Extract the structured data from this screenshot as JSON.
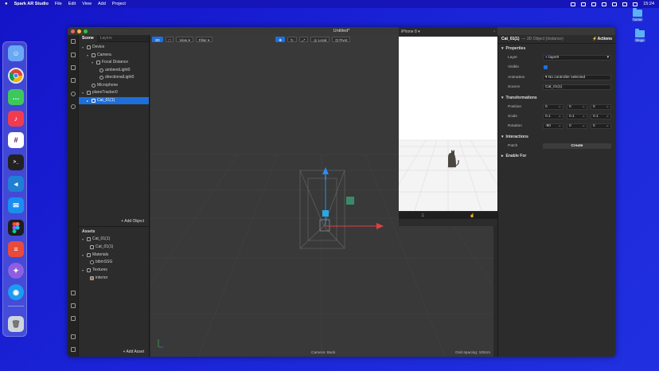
{
  "menubar": {
    "apple": "",
    "app": "Spark AR Studio",
    "items": [
      "File",
      "Edit",
      "View",
      "Add",
      "Project"
    ],
    "time": "15:24"
  },
  "desktop_icons": [
    {
      "label": "home"
    },
    {
      "label": "blogo"
    }
  ],
  "window": {
    "title": "Untitled*"
  },
  "scene_panel": {
    "tabs": [
      "Scene",
      "Layers"
    ],
    "tree": [
      {
        "label": "Device",
        "depth": 0
      },
      {
        "label": "Camera",
        "depth": 1
      },
      {
        "label": "Focal Distance",
        "depth": 2
      },
      {
        "label": "ambientLight0",
        "depth": 3
      },
      {
        "label": "directionalLight0",
        "depth": 3
      },
      {
        "label": "Microphone",
        "depth": 1
      },
      {
        "label": "planeTracker0",
        "depth": 0
      },
      {
        "label": "Cat_01(1)",
        "depth": 1,
        "selected": true
      }
    ],
    "add_object": "+ Add Object"
  },
  "assets_panel": {
    "title": "Assets",
    "tree": [
      {
        "label": "Cat_01(1)",
        "depth": 0
      },
      {
        "label": "Cat_01(1)",
        "depth": 1
      },
      {
        "label": "Materials",
        "depth": 0
      },
      {
        "label": "bibmSSG",
        "depth": 1
      },
      {
        "label": "Textures",
        "depth": 0
      },
      {
        "label": "interior",
        "depth": 1
      }
    ],
    "add_asset": "+ Add Asset"
  },
  "viewport": {
    "toolbar": {
      "view_3d": "3D",
      "view": "View",
      "filter": "Filter",
      "local": "Local",
      "pivot": "Pivot"
    },
    "camera_status": "Camera: Back",
    "grid_status": "Grid spacing: 100cm"
  },
  "simulator": {
    "device": "iPhone 8"
  },
  "properties": {
    "header": {
      "name": "Cat_01(1)",
      "type": "— 3D Object (Instance)",
      "actions": "Actions"
    },
    "sections": {
      "properties": "Properties",
      "transformations": "Transformations",
      "interactions": "Interactions",
      "enable_for": "Enable For"
    },
    "layer": {
      "label": "Layer",
      "value": "layer0"
    },
    "visible": {
      "label": "Visible"
    },
    "animation": {
      "label": "Animation",
      "value": "No controller selected"
    },
    "source": {
      "label": "Source",
      "value": "Cat_01(1)"
    },
    "position": {
      "label": "Position",
      "x": "0",
      "y": "0",
      "z": "0"
    },
    "scale": {
      "label": "Scale",
      "x": "0.1",
      "y": "0.1",
      "z": "0.1"
    },
    "rotation": {
      "label": "Rotation",
      "x": "-90",
      "y": "0",
      "z": "0"
    },
    "patch": {
      "label": "Patch",
      "button": "Create"
    }
  },
  "colors": {
    "accent": "#1e6fd9",
    "desktop": "#1a22d6"
  }
}
